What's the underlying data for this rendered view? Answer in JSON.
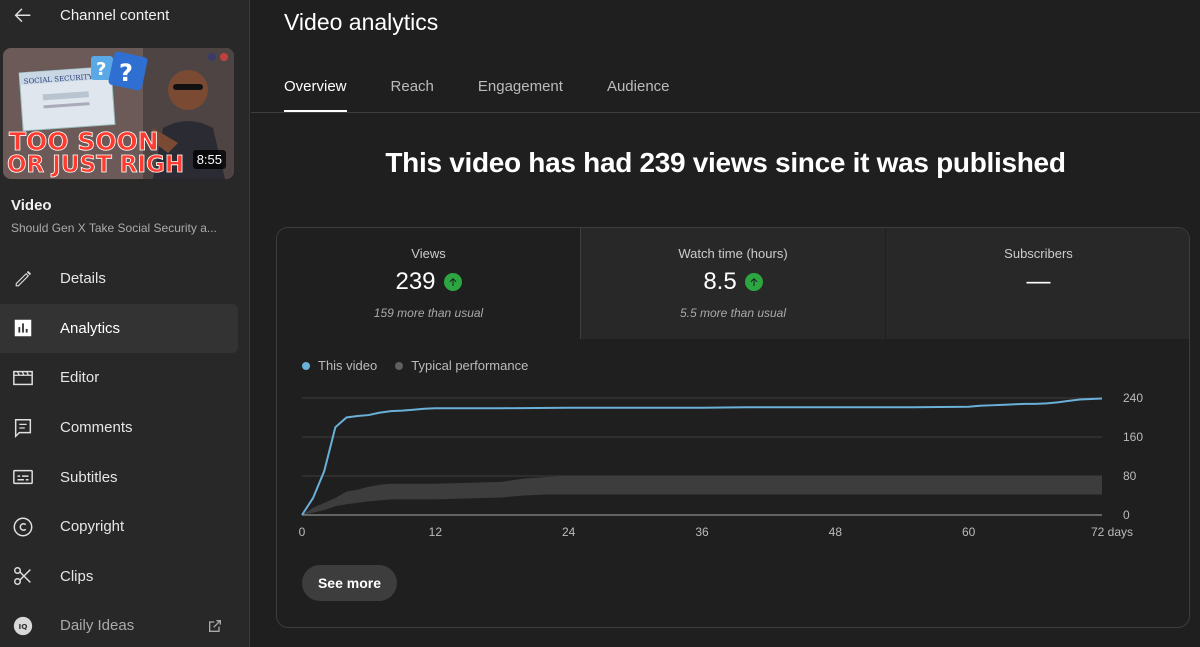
{
  "sidebar": {
    "title": "Channel content",
    "video": {
      "thumbnail_text_line1": "TOO SOON",
      "thumbnail_text_line2": "OR JUST RIGH",
      "card_text": "SOCIAL SECURITY",
      "duration": "8:55",
      "label": "Video",
      "title": "Should Gen X Take Social Security a..."
    },
    "items": [
      {
        "label": "Details",
        "icon": "pencil-icon"
      },
      {
        "label": "Analytics",
        "icon": "analytics-icon"
      },
      {
        "label": "Editor",
        "icon": "editor-icon"
      },
      {
        "label": "Comments",
        "icon": "comments-icon"
      },
      {
        "label": "Subtitles",
        "icon": "subtitles-icon"
      },
      {
        "label": "Copyright",
        "icon": "copyright-icon"
      },
      {
        "label": "Clips",
        "icon": "scissors-icon"
      },
      {
        "label": "Daily Ideas",
        "icon": "daily-ideas-icon",
        "badge": "IQ"
      }
    ]
  },
  "main": {
    "title": "Video analytics",
    "tabs": [
      {
        "label": "Overview"
      },
      {
        "label": "Reach"
      },
      {
        "label": "Engagement"
      },
      {
        "label": "Audience"
      }
    ],
    "headline": "This video has had 239 views since it was published",
    "metrics": [
      {
        "label": "Views",
        "value": "239",
        "trend": "up",
        "note": "159 more than usual"
      },
      {
        "label": "Watch time (hours)",
        "value": "8.5",
        "trend": "up",
        "note": "5.5 more than usual"
      },
      {
        "label": "Subscribers",
        "value": "—",
        "note": ""
      }
    ],
    "legend": {
      "this_video": "This video",
      "typical": "Typical performance"
    },
    "see_more": "See more"
  },
  "colors": {
    "accent_line": "#6ab0d8",
    "typical_band": "#3d3d3d",
    "trend_up": "#2ba640"
  },
  "chart_data": {
    "type": "line",
    "x_tick_labels": [
      "0",
      "12",
      "24",
      "36",
      "48",
      "60",
      "72 days"
    ],
    "x_ticks": [
      0,
      12,
      24,
      36,
      48,
      60,
      72
    ],
    "xlim": [
      0,
      72
    ],
    "y_tick_labels": [
      "0",
      "80",
      "160",
      "240"
    ],
    "y_ticks": [
      0,
      80,
      160,
      240
    ],
    "ylim": [
      0,
      240
    ],
    "grid": true,
    "legend_position": "top-left",
    "series": [
      {
        "name": "This video",
        "x": [
          0,
          1,
          2,
          3,
          4,
          5,
          6,
          7,
          8,
          9,
          10,
          11,
          12,
          18,
          24,
          30,
          36,
          40,
          48,
          55,
          60,
          61,
          62,
          63,
          64,
          65,
          66,
          67,
          68,
          69,
          70,
          71,
          72
        ],
        "values": [
          0,
          35,
          90,
          180,
          200,
          203,
          205,
          210,
          213,
          214,
          216,
          218,
          219,
          219,
          220,
          220,
          220,
          221,
          221,
          221,
          222,
          224,
          225,
          226,
          227,
          228,
          228,
          229,
          231,
          234,
          237,
          238,
          239
        ]
      },
      {
        "name": "Typical performance",
        "band": true,
        "x": [
          0,
          1,
          2,
          3,
          4,
          5,
          6,
          7,
          8,
          12,
          18,
          20,
          22,
          24,
          30,
          36,
          48,
          60,
          72
        ],
        "lower": [
          0,
          5,
          10,
          18,
          22,
          25,
          28,
          30,
          32,
          32,
          36,
          40,
          42,
          42,
          42,
          42,
          42,
          42,
          42
        ],
        "upper": [
          0,
          15,
          25,
          35,
          48,
          52,
          58,
          62,
          64,
          64,
          68,
          75,
          78,
          80,
          80,
          80,
          80,
          80,
          80
        ]
      }
    ]
  }
}
